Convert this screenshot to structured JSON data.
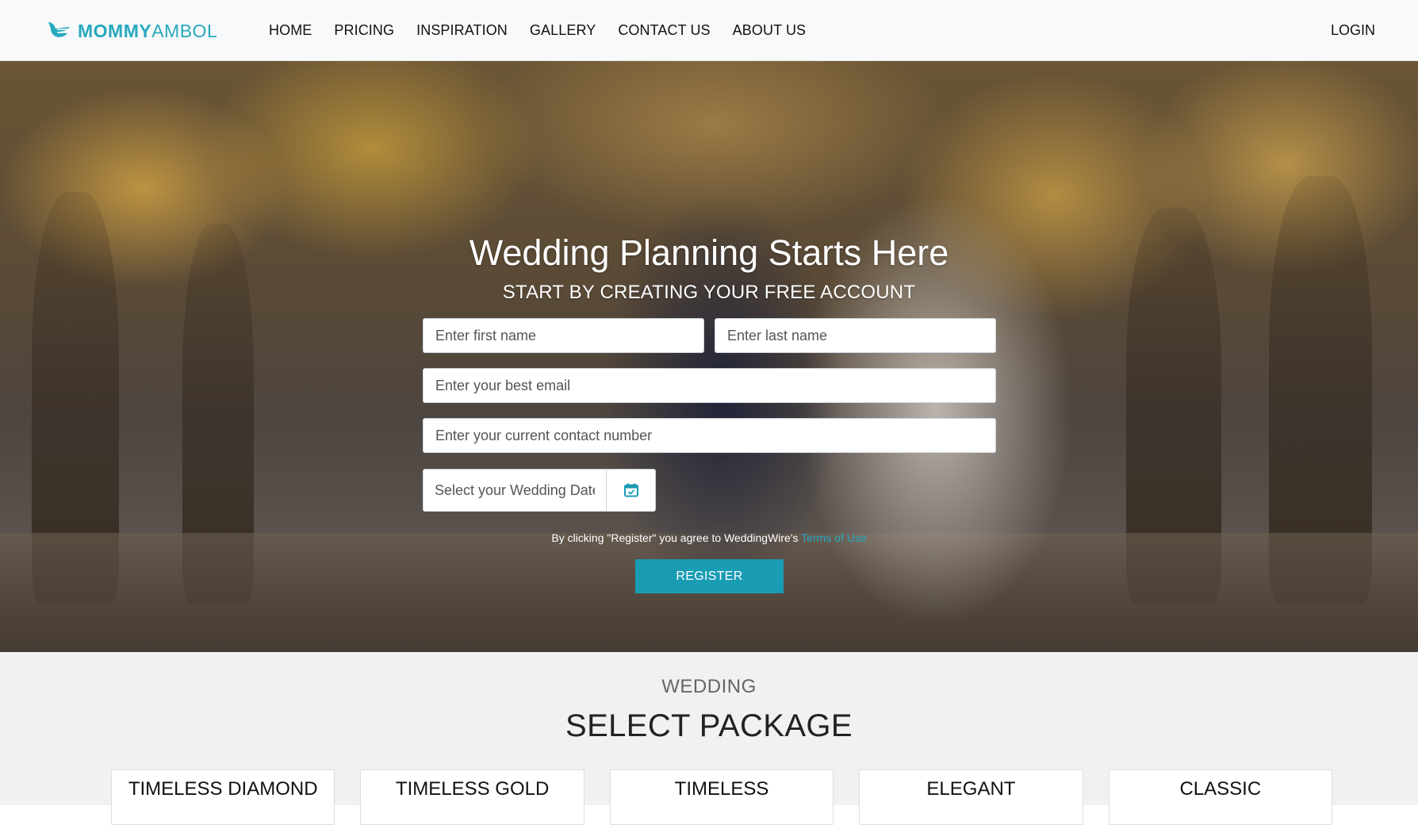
{
  "brand": {
    "name_bold": "MOMMY",
    "name_light": "AMBOL",
    "color": "#27a9bd"
  },
  "nav": {
    "items": [
      {
        "label": "HOME"
      },
      {
        "label": "PRICING"
      },
      {
        "label": "INSPIRATION"
      },
      {
        "label": "GALLERY"
      },
      {
        "label": "CONTACT US"
      },
      {
        "label": "ABOUT US"
      }
    ],
    "login": "LOGIN"
  },
  "hero": {
    "title": "Wedding Planning Starts Here",
    "subtitle": "START BY CREATING YOUR FREE ACCOUNT",
    "form": {
      "first_name_placeholder": "Enter first name",
      "last_name_placeholder": "Enter last name",
      "email_placeholder": "Enter your best email",
      "phone_placeholder": "Enter your current contact number",
      "date_placeholder": "Select your Wedding Date",
      "date_icon": "calendar-check-icon"
    },
    "terms_prefix": "By clicking \"Register\" you agree to WeddingWire's ",
    "terms_link": "Terms of Use",
    "register_label": "REGISTER",
    "accent_color": "#1a9cb4"
  },
  "packages": {
    "eyebrow": "WEDDING",
    "title": "SELECT PACKAGE",
    "items": [
      {
        "label": "TIMELESS DIAMOND"
      },
      {
        "label": "TIMELESS GOLD"
      },
      {
        "label": "TIMELESS"
      },
      {
        "label": "ELEGANT"
      },
      {
        "label": "CLASSIC"
      }
    ]
  }
}
